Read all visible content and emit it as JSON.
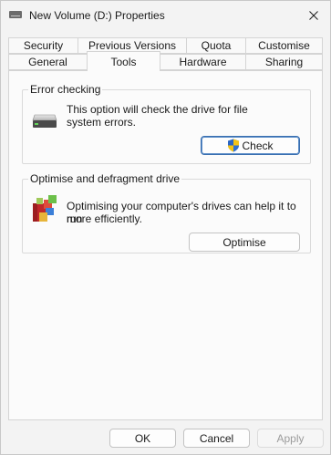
{
  "window": {
    "title": "New Volume (D:) Properties",
    "title_icon": "drive-icon",
    "close_icon": "close-icon"
  },
  "tabs": {
    "row1": [
      "Security",
      "Previous Versions",
      "Quota",
      "Customise"
    ],
    "row2": [
      "General",
      "Tools",
      "Hardware",
      "Sharing"
    ],
    "active": "Tools"
  },
  "error_checking": {
    "title": "Error checking",
    "description_line1": "This option will check the drive for file",
    "description_line2": "system errors.",
    "button_label": "Check",
    "icon": "hard-drive-icon",
    "button_icon": "uac-shield-icon"
  },
  "optimise": {
    "title": "Optimise and defragment drive",
    "description_line1": "Optimising your computer's drives can help it to run",
    "description_line2": "more efficiently.",
    "button_label": "Optimise",
    "icon": "defrag-icon"
  },
  "footer": {
    "ok_label": "OK",
    "cancel_label": "Cancel",
    "apply_label": "Apply"
  },
  "colors": {
    "accent_border": "#3a6fb0",
    "window_bg": "#f3f3f3",
    "panel_bg": "#fbfbfb"
  }
}
